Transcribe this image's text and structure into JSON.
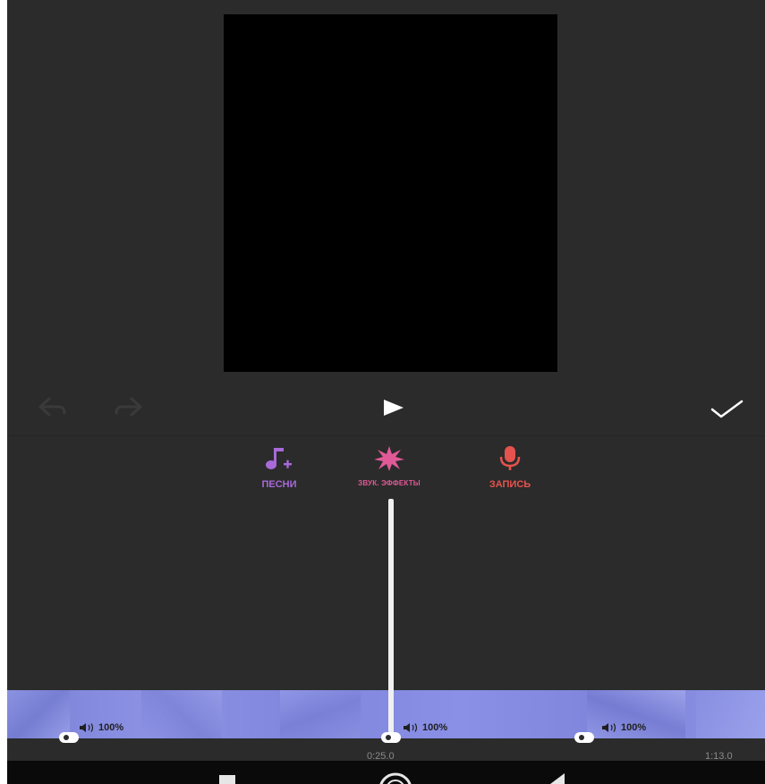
{
  "editor": {
    "undo_icon": "undo-arrow-icon",
    "redo_icon": "redo-arrow-icon",
    "play_icon": "play-icon",
    "confirm_icon": "checkmark-icon"
  },
  "tools": [
    {
      "label": "ПЕСНИ",
      "icon": "music-note-add-icon",
      "color": "#a86ad8"
    },
    {
      "label": "ЗВУК. ЭФФЕКТЫ",
      "icon": "burst-star-icon",
      "color": "#e05a97"
    },
    {
      "label": "ЗАПИСЬ",
      "icon": "microphone-icon",
      "color": "#e4534d"
    }
  ],
  "timeline": {
    "clips": [
      {
        "volume": "100%"
      },
      {
        "volume": "100%"
      },
      {
        "volume": "100%"
      }
    ],
    "current_time": "0:25.0",
    "total_time": "1:13.0",
    "strip_color": "#8088dc"
  },
  "nav": {
    "recent_icon": "recent-apps-icon",
    "home_icon": "home-icon",
    "back_icon": "back-triangle-icon"
  }
}
